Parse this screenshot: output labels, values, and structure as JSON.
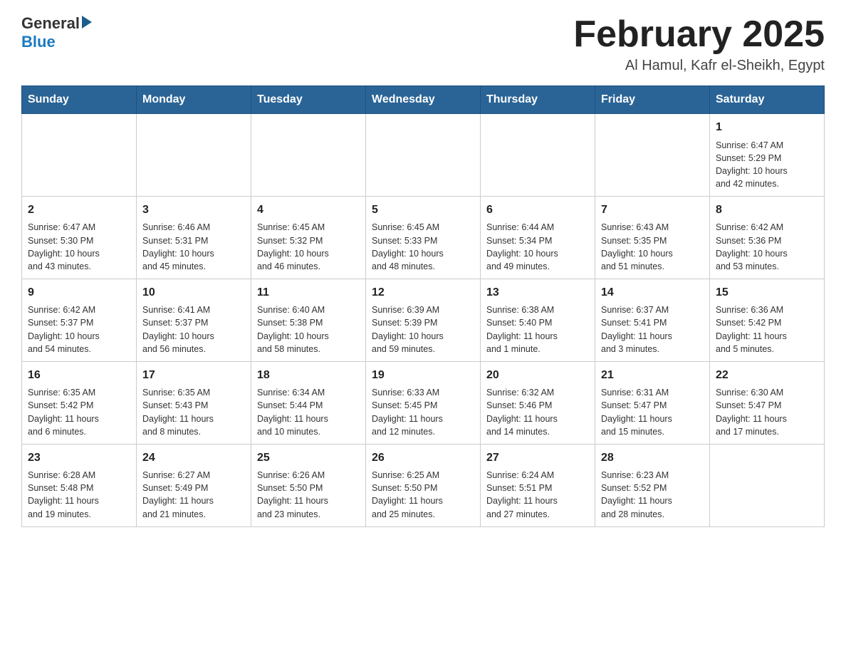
{
  "header": {
    "logo_general": "General",
    "logo_blue": "Blue",
    "month_title": "February 2025",
    "location": "Al Hamul, Kafr el-Sheikh, Egypt"
  },
  "weekdays": [
    "Sunday",
    "Monday",
    "Tuesday",
    "Wednesday",
    "Thursday",
    "Friday",
    "Saturday"
  ],
  "weeks": [
    [
      {
        "day": "",
        "info": ""
      },
      {
        "day": "",
        "info": ""
      },
      {
        "day": "",
        "info": ""
      },
      {
        "day": "",
        "info": ""
      },
      {
        "day": "",
        "info": ""
      },
      {
        "day": "",
        "info": ""
      },
      {
        "day": "1",
        "info": "Sunrise: 6:47 AM\nSunset: 5:29 PM\nDaylight: 10 hours\nand 42 minutes."
      }
    ],
    [
      {
        "day": "2",
        "info": "Sunrise: 6:47 AM\nSunset: 5:30 PM\nDaylight: 10 hours\nand 43 minutes."
      },
      {
        "day": "3",
        "info": "Sunrise: 6:46 AM\nSunset: 5:31 PM\nDaylight: 10 hours\nand 45 minutes."
      },
      {
        "day": "4",
        "info": "Sunrise: 6:45 AM\nSunset: 5:32 PM\nDaylight: 10 hours\nand 46 minutes."
      },
      {
        "day": "5",
        "info": "Sunrise: 6:45 AM\nSunset: 5:33 PM\nDaylight: 10 hours\nand 48 minutes."
      },
      {
        "day": "6",
        "info": "Sunrise: 6:44 AM\nSunset: 5:34 PM\nDaylight: 10 hours\nand 49 minutes."
      },
      {
        "day": "7",
        "info": "Sunrise: 6:43 AM\nSunset: 5:35 PM\nDaylight: 10 hours\nand 51 minutes."
      },
      {
        "day": "8",
        "info": "Sunrise: 6:42 AM\nSunset: 5:36 PM\nDaylight: 10 hours\nand 53 minutes."
      }
    ],
    [
      {
        "day": "9",
        "info": "Sunrise: 6:42 AM\nSunset: 5:37 PM\nDaylight: 10 hours\nand 54 minutes."
      },
      {
        "day": "10",
        "info": "Sunrise: 6:41 AM\nSunset: 5:37 PM\nDaylight: 10 hours\nand 56 minutes."
      },
      {
        "day": "11",
        "info": "Sunrise: 6:40 AM\nSunset: 5:38 PM\nDaylight: 10 hours\nand 58 minutes."
      },
      {
        "day": "12",
        "info": "Sunrise: 6:39 AM\nSunset: 5:39 PM\nDaylight: 10 hours\nand 59 minutes."
      },
      {
        "day": "13",
        "info": "Sunrise: 6:38 AM\nSunset: 5:40 PM\nDaylight: 11 hours\nand 1 minute."
      },
      {
        "day": "14",
        "info": "Sunrise: 6:37 AM\nSunset: 5:41 PM\nDaylight: 11 hours\nand 3 minutes."
      },
      {
        "day": "15",
        "info": "Sunrise: 6:36 AM\nSunset: 5:42 PM\nDaylight: 11 hours\nand 5 minutes."
      }
    ],
    [
      {
        "day": "16",
        "info": "Sunrise: 6:35 AM\nSunset: 5:42 PM\nDaylight: 11 hours\nand 6 minutes."
      },
      {
        "day": "17",
        "info": "Sunrise: 6:35 AM\nSunset: 5:43 PM\nDaylight: 11 hours\nand 8 minutes."
      },
      {
        "day": "18",
        "info": "Sunrise: 6:34 AM\nSunset: 5:44 PM\nDaylight: 11 hours\nand 10 minutes."
      },
      {
        "day": "19",
        "info": "Sunrise: 6:33 AM\nSunset: 5:45 PM\nDaylight: 11 hours\nand 12 minutes."
      },
      {
        "day": "20",
        "info": "Sunrise: 6:32 AM\nSunset: 5:46 PM\nDaylight: 11 hours\nand 14 minutes."
      },
      {
        "day": "21",
        "info": "Sunrise: 6:31 AM\nSunset: 5:47 PM\nDaylight: 11 hours\nand 15 minutes."
      },
      {
        "day": "22",
        "info": "Sunrise: 6:30 AM\nSunset: 5:47 PM\nDaylight: 11 hours\nand 17 minutes."
      }
    ],
    [
      {
        "day": "23",
        "info": "Sunrise: 6:28 AM\nSunset: 5:48 PM\nDaylight: 11 hours\nand 19 minutes."
      },
      {
        "day": "24",
        "info": "Sunrise: 6:27 AM\nSunset: 5:49 PM\nDaylight: 11 hours\nand 21 minutes."
      },
      {
        "day": "25",
        "info": "Sunrise: 6:26 AM\nSunset: 5:50 PM\nDaylight: 11 hours\nand 23 minutes."
      },
      {
        "day": "26",
        "info": "Sunrise: 6:25 AM\nSunset: 5:50 PM\nDaylight: 11 hours\nand 25 minutes."
      },
      {
        "day": "27",
        "info": "Sunrise: 6:24 AM\nSunset: 5:51 PM\nDaylight: 11 hours\nand 27 minutes."
      },
      {
        "day": "28",
        "info": "Sunrise: 6:23 AM\nSunset: 5:52 PM\nDaylight: 11 hours\nand 28 minutes."
      },
      {
        "day": "",
        "info": ""
      }
    ]
  ]
}
